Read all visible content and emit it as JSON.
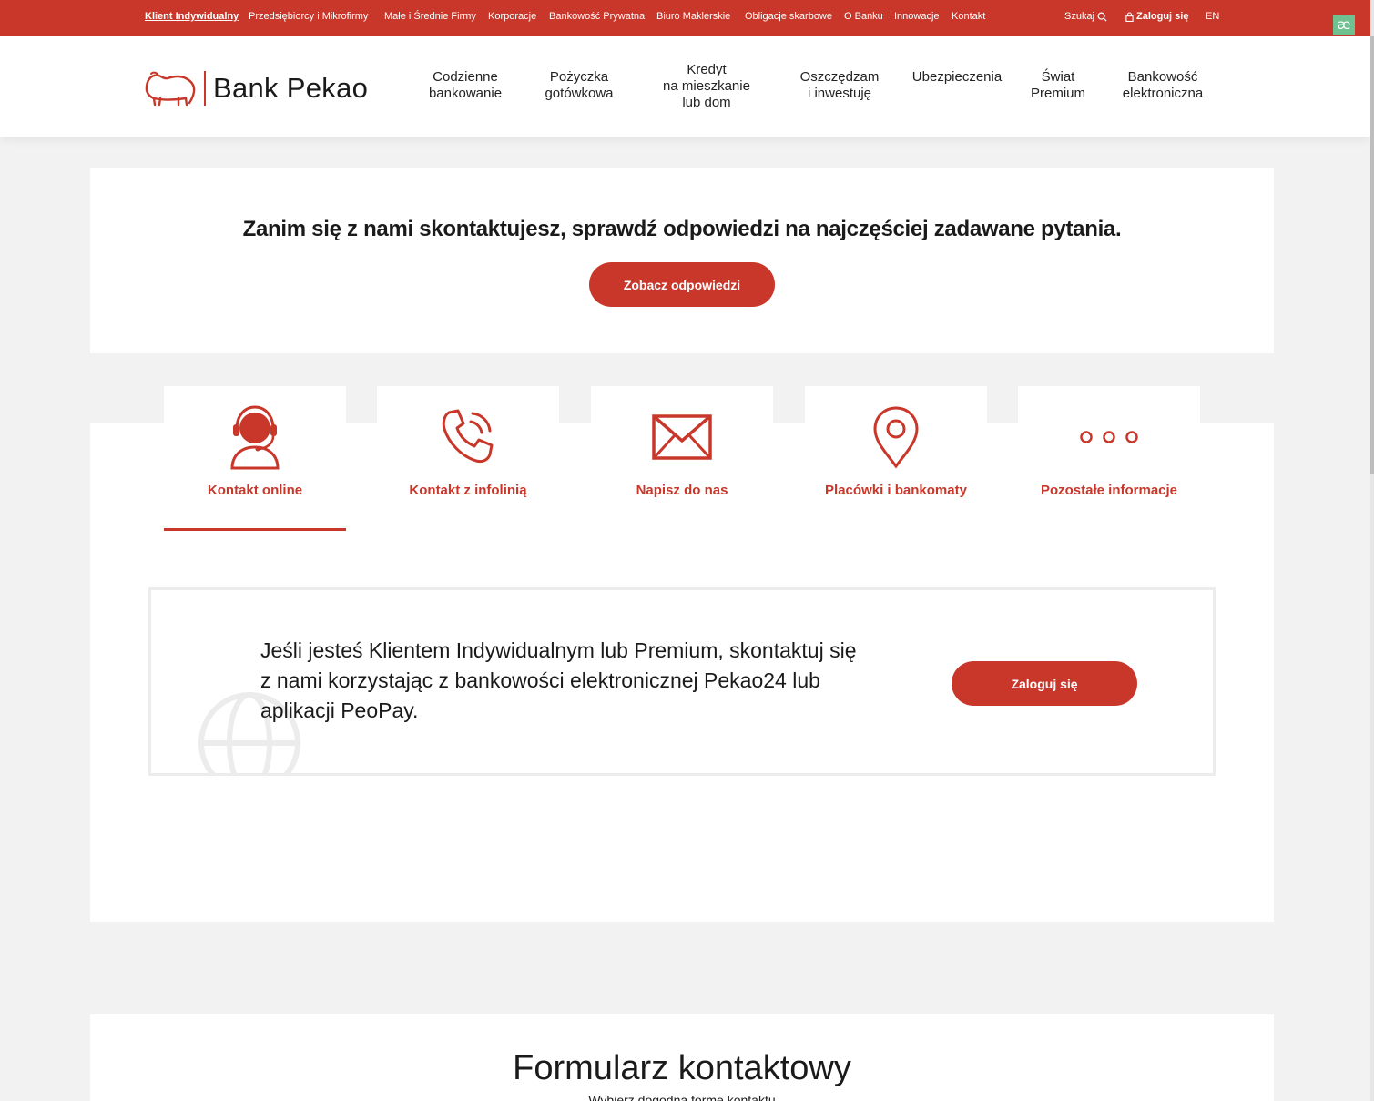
{
  "topbar": {
    "segments": [
      "Klient Indywidualny",
      "Przedsiębiorcy i Mikrofirmy",
      "Małe i Średnie Firmy",
      "Korporacje",
      "Bankowość Prywatna",
      "Biuro Maklerskie",
      "Obligacje skarbowe",
      "O Banku",
      "Innowacje",
      "Kontakt"
    ],
    "search_label": "Szukaj",
    "login_label": "Zaloguj się",
    "lang_label": "EN",
    "badge_label": "æ"
  },
  "header": {
    "logo_text": "Bank Pekao",
    "nav": [
      {
        "lines": [
          "Codzienne",
          "bankowanie"
        ]
      },
      {
        "lines": [
          "Pożyczka",
          "gotówkowa"
        ]
      },
      {
        "lines": [
          "Kredyt",
          "na mieszkanie",
          "lub dom"
        ]
      },
      {
        "lines": [
          "Oszczędzam",
          "i inwestuję"
        ]
      },
      {
        "lines": [
          "Ubezpieczenia"
        ]
      },
      {
        "lines": [
          "Świat",
          "Premium"
        ]
      },
      {
        "lines": [
          "Bankowość",
          "elektroniczna"
        ]
      }
    ]
  },
  "faq": {
    "title": "Zanim się z nami skontaktujesz, sprawdź odpowiedzi na najczęściej zadawane pytania.",
    "button_label": "Zobacz odpowiedzi"
  },
  "tabs": {
    "items": [
      {
        "label": "Kontakt online",
        "icon": "headset-agent-icon",
        "active": true
      },
      {
        "label": "Kontakt z infolinią",
        "icon": "phone-ringing-icon",
        "active": false
      },
      {
        "label": "Napisz do nas",
        "icon": "envelope-icon",
        "active": false
      },
      {
        "label": "Placówki i bankomaty",
        "icon": "map-pin-icon",
        "active": false
      },
      {
        "label": "Pozostałe informacje",
        "icon": "more-dots-icon",
        "active": false
      }
    ]
  },
  "info": {
    "text": "Jeśli jesteś Klientem Indywidualnym lub Premium, skontaktuj się z nami korzystając z bankowości elektronicznej Pekao24 lub aplikacji PeoPay.",
    "button_label": "Zaloguj się"
  },
  "form": {
    "title": "Formularz kontaktowy",
    "subtitle": "Wybierz dogodną formę kontaktu"
  },
  "colors": {
    "brand_red": "#c8372a",
    "background": "#f2f2f2",
    "badge_green": "#6fc28f"
  }
}
